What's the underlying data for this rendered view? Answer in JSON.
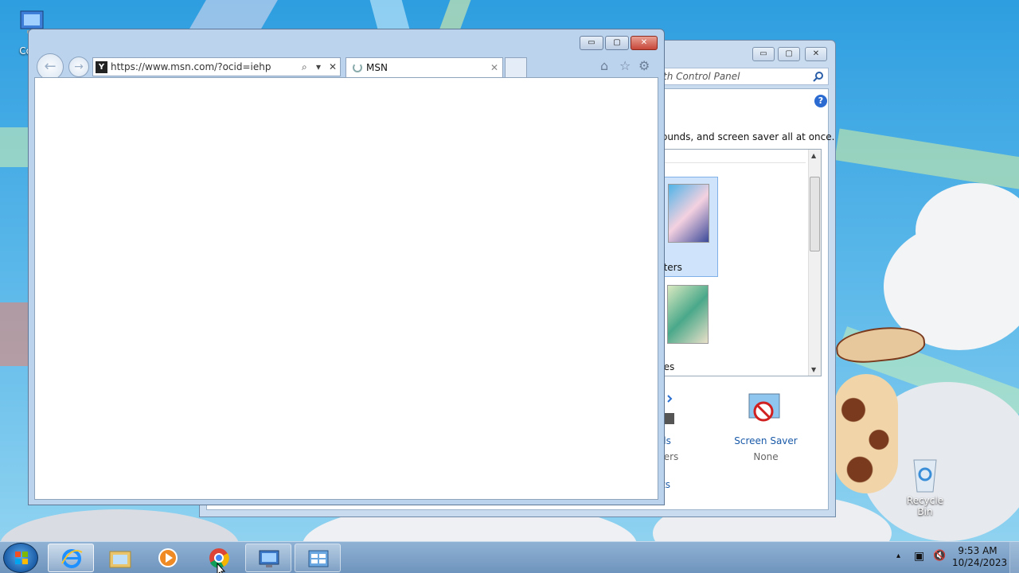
{
  "desktop": {
    "icons": {
      "computer_label": "Com",
      "recycle_bin_label": "Recycle Bin"
    }
  },
  "control_panel": {
    "search_placeholder": "th Control Panel",
    "help_label": "?",
    "description": "ounds, and screen saver all at once.",
    "themes": [
      {
        "label": "cters"
      },
      {
        "label": "nes"
      }
    ],
    "settings": [
      {
        "link": "ds",
        "sub": "ters"
      },
      {
        "link": "Screen Saver",
        "sub": "None"
      }
    ],
    "extra_link": "ts",
    "buttons": {
      "minimize": "▭",
      "maximize": "▢",
      "close": "✕"
    }
  },
  "browser": {
    "address_url": "https://www.msn.com/?ocid=iehp",
    "address_search_glyph": "⌕",
    "address_dropdown_glyph": "▾",
    "address_stop_glyph": "✕",
    "favicon_text": "Y",
    "tab_title": "MSN",
    "tab_close": "✕",
    "toolbar": {
      "home": "⌂",
      "favorites": "☆",
      "tools": "⚙"
    },
    "buttons": {
      "minimize": "▭",
      "maximize": "▢",
      "close": "✕"
    },
    "nav": {
      "back": "←",
      "forward": "→"
    }
  },
  "taskbar": {
    "items": [
      {
        "name": "internet-explorer",
        "state": "active"
      },
      {
        "name": "file-explorer",
        "state": "pinned"
      },
      {
        "name": "media-player",
        "state": "pinned"
      },
      {
        "name": "chrome",
        "state": "pinned"
      },
      {
        "name": "remote-desktop",
        "state": "open"
      },
      {
        "name": "control-panel",
        "state": "open"
      }
    ],
    "tray": {
      "overflow": "▴",
      "network": "▣",
      "volume": "🔇"
    },
    "time": "9:53 AM",
    "date": "10/24/2023"
  }
}
